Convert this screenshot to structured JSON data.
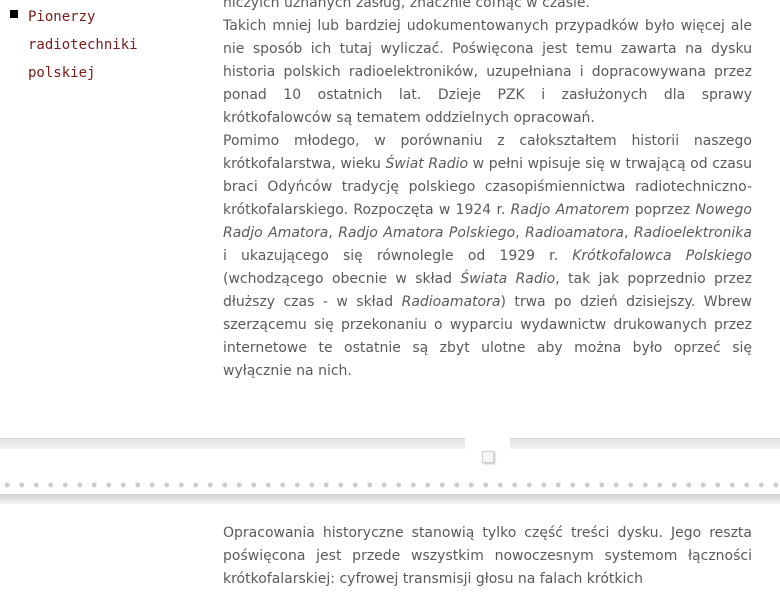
{
  "sidebar": {
    "items": [
      {
        "lines": [
          "Pionerzy",
          "radiotechniki",
          "polskiej"
        ]
      }
    ]
  },
  "content_top": {
    "p1": "niczyich uznanych zasług, znacznie cofnąć w czasie.",
    "p2": "Takich mniej lub bardziej udokumentowanych przypadków było więcej ale nie sposób ich tutaj wyliczać. Poświęcona jest temu zawarta na dysku historia polskich radioelektroników, uzupełniana i dopracowywana przez ponad 10 ostatnich lat. Dzieje PZK i zasłużonych dla sprawy krótkofalowców są tematem oddzielnych opracowań.",
    "p3": {
      "t1": "Pomimo młodego, w porównaniu z całokształtem historii naszego krótkofalarstwa, wieku ",
      "i1": "Świat Radio",
      "t2": " w pełni wpisuje się w trwającą od czasu braci Odyńców tradycję polskiego czasopiśmiennictwa radiotechniczno-krótkofalarskiego. Rozpoczęta w 1924 r. ",
      "i2": "Radjo Amatorem",
      "t3": " poprzez ",
      "i3": "Nowego Radjo Amatora",
      "t4": ", ",
      "i4": "Radjo Amatora Polskiego",
      "t5": ", ",
      "i5": "Radioamatora",
      "t6": ", ",
      "i6": "Radioelektronika",
      "t7": " i ukazującego się równolegle od 1929 r. ",
      "i7": "Krótkofalowca Polskiego",
      "t8": " (wchodzącego obecnie w skład ",
      "i8": "Świata Radio",
      "t9": ", tak jak poprzednio przez dłuższy czas - w skład ",
      "i9": "Radioamatora",
      "t10": ") trwa po dzień dzisiejszy. Wbrew szerzącemu się przekonaniu o wyparciu wydawnictw drukowanych przez internetowe te ostatnie są zbyt ulotne aby można było oprzeć się wyłącznie na nich."
    }
  },
  "content_bottom": {
    "p1": "Opracowania historyczne stanowią tylko część treści dysku. Jego reszta poświęcona jest przede wszystkim nowoczesnym systemom łączności krótkofalarskiej: cyfrowej transmisji głosu na falach krótkich"
  }
}
